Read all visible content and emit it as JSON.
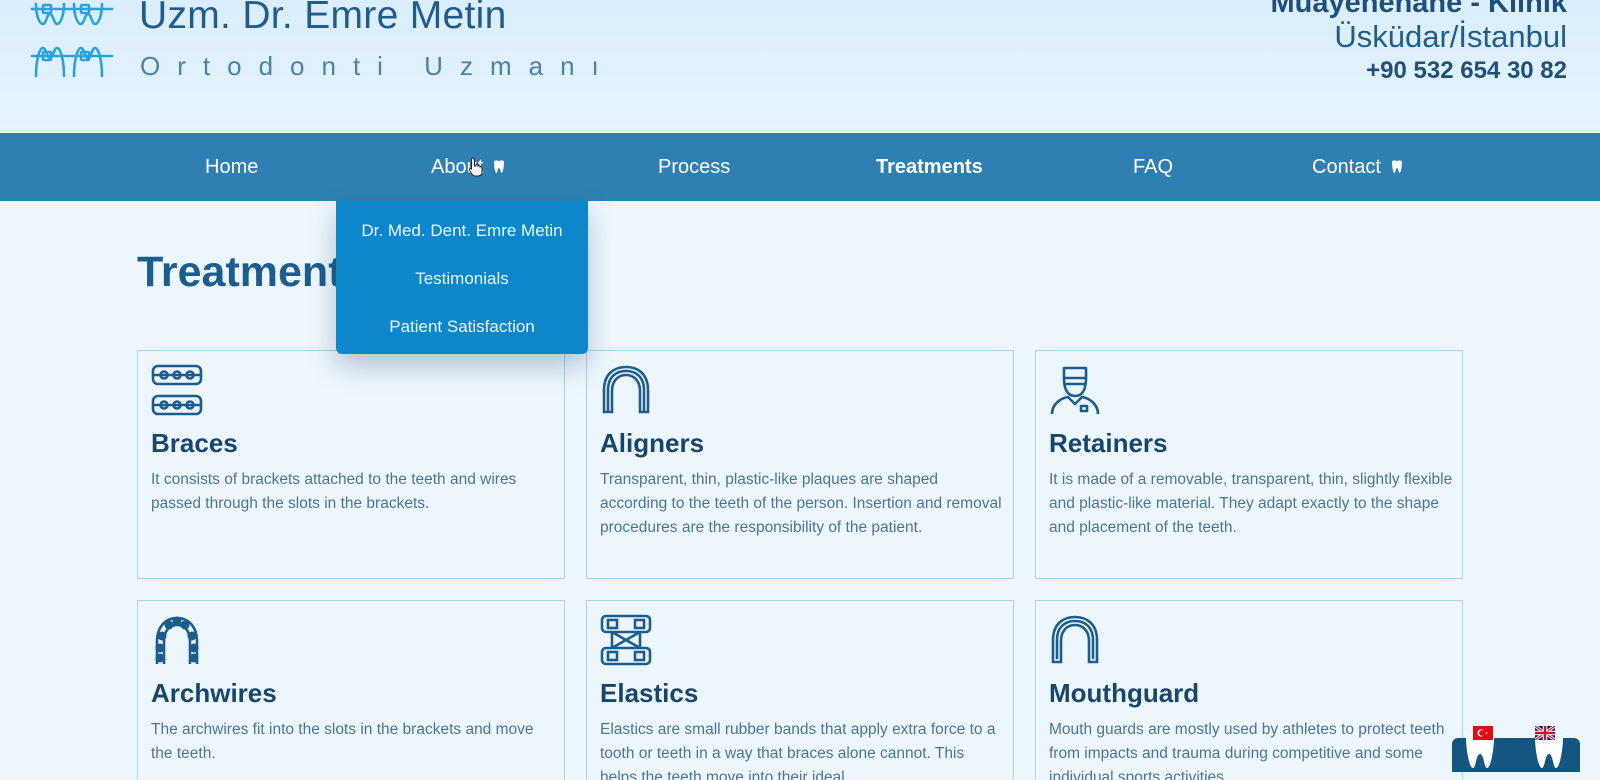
{
  "header": {
    "doctor_name": "Uzm. Dr. Emre Metin",
    "doctor_title": "Ortodonti Uzmanı",
    "clinic_name": "Muayenehane - Klinik",
    "clinic_city": "Üsküdar/İstanbul",
    "clinic_phone": "+90 532 654 30 82"
  },
  "nav": {
    "items": [
      {
        "label": "Home",
        "icon": ""
      },
      {
        "label": "About",
        "icon": "tooth-icon"
      },
      {
        "label": "Process",
        "icon": ""
      },
      {
        "label": "Treatments",
        "icon": "",
        "active": true
      },
      {
        "label": "FAQ",
        "icon": ""
      },
      {
        "label": "Contact",
        "icon": "tooth-icon"
      }
    ],
    "about_dropdown": [
      "Dr. Med. Dent. Emre Metin",
      "Testimonials",
      "Patient Satisfaction"
    ]
  },
  "page": {
    "title": "Treatments"
  },
  "cards": [
    {
      "icon": "braces-icon",
      "title": "Braces",
      "text": "It consists of brackets attached to the teeth and wires passed through the slots in the brackets."
    },
    {
      "icon": "aligner-icon",
      "title": "Aligners",
      "text": "Transparent, thin, plastic-like plaques are shaped according to the teeth of the person. Insertion and removal procedures are the responsibility of the patient."
    },
    {
      "icon": "dentist-icon",
      "title": "Retainers",
      "text": "It is made of a removable, transparent, thin, slightly flexible and plastic-like material. They adapt exactly to the shape and placement of the teeth."
    },
    {
      "icon": "archwire-icon",
      "title": "Archwires",
      "text": "The archwires fit into the slots in the brackets and move the teeth."
    },
    {
      "icon": "elastics-icon",
      "title": "Elastics",
      "text": "Elastics are small rubber bands that apply extra force to a tooth or teeth in a way that braces alone cannot. This helps the teeth move into their ideal"
    },
    {
      "icon": "mouthguard-icon",
      "title": "Mouthguard",
      "text": "Mouth guards are mostly used by athletes to protect teeth from impacts and trauma during competitive and some individual sports activities."
    }
  ],
  "language": {
    "options": [
      "turkish-flag-icon",
      "uk-flag-icon"
    ]
  },
  "colors": {
    "nav_bg": "#2e80b3",
    "dropdown_bg": "#0c87cc",
    "title": "#1b5d8c",
    "card_border": "#a9d3ec"
  }
}
